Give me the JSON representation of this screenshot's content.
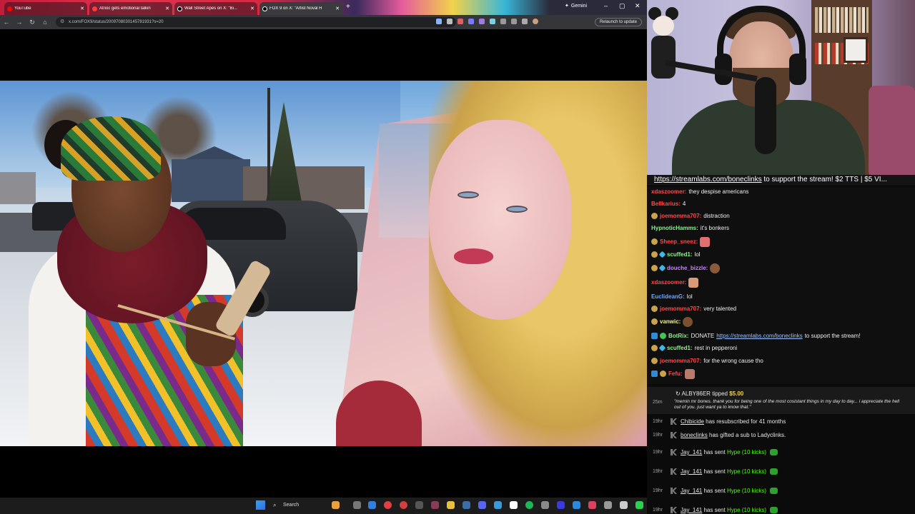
{
  "browser": {
    "tabs": [
      {
        "label": "YouTube"
      },
      {
        "label": "Atrioc gets emotional talkin"
      },
      {
        "label": "Wall Street Apes on X: \"Bi..."
      },
      {
        "label": "FOX 9 on X: \"Artist Noval H"
      }
    ],
    "profile_label": "Gemini",
    "url": "x.com/FOX9/status/2009708030145781931?s=20",
    "relaunch_label": "Relaunch to update"
  },
  "stream": {
    "ticker_link": "https://streamlabs.com/boneclinks",
    "ticker_text": " to support the stream! $2 TTS | $5 VI..."
  },
  "chat": {
    "messages": [
      {
        "user": "",
        "text": "they despise americans",
        "user_color": "#ff4a4a"
      },
      {
        "user": "Bellkarius:",
        "text": "4",
        "user_color": "#ff4a4a"
      },
      {
        "user": "joemomma707:",
        "text": "distraction",
        "user_color": "#ff4a4a"
      },
      {
        "user": "HypnoticHamms:",
        "text": "it's bonkers",
        "user_color": "#8ff28f"
      },
      {
        "user": "Sheep_sneez:",
        "text": "",
        "user_color": "#ff4a4a"
      },
      {
        "user": "scuffed1:",
        "text": "lol",
        "user_color": "#8ff28f"
      },
      {
        "user": "douche_bizzle:",
        "text": "",
        "user_color": "#c983ff"
      },
      {
        "user": "xdaszoomer:",
        "text": "",
        "user_color": "#ff4a4a"
      },
      {
        "user": "EuclideanG:",
        "text": "lol",
        "user_color": "#6fa8ff"
      },
      {
        "user": "joemomma707:",
        "text": "very talented",
        "user_color": "#ff4a4a"
      },
      {
        "user": "vanwic:",
        "text": "",
        "user_color": "#f2f28f"
      },
      {
        "user": "BotRix:",
        "text": "DONATE ",
        "link": "https://streamlabs.com/boneclinks",
        "text2": " to support the stream!",
        "user_color": "#8ff28f"
      },
      {
        "user": "scuffed1:",
        "text": "rest in pepperoni",
        "user_color": "#8ff28f"
      },
      {
        "user": "joemomma707:",
        "text": "for the wrong cause tho",
        "user_color": "#ff4a4a"
      },
      {
        "user": "Fefu:",
        "text": "",
        "user_color": "#ff4a4a"
      }
    ]
  },
  "events": {
    "tip": {
      "time": "25m",
      "user": "ALBY86ER",
      "action": "tipped",
      "amount": "$5.00",
      "message": "\"memin mr bones. thank you for being one of the most cosistant things in my day to day... i appreciate the hell out of you. just want ya to know that.\""
    },
    "items": [
      {
        "time": "19hr",
        "user": "Chibicide",
        "text": " has resubscribed for 41 months",
        "hype": ""
      },
      {
        "time": "19hr",
        "user": "boneclinks",
        "text": " has gifted a sub to Ladyclinks.",
        "hype": ""
      },
      {
        "time": "19hr",
        "user": "Jay_141",
        "text": " has sent ",
        "hype": "Hype (10 kicks)"
      },
      {
        "time": "19hr",
        "user": "Jay_141",
        "text": " has sent ",
        "hype": "Hype (10 kicks)"
      },
      {
        "time": "19hr",
        "user": "Jay_141",
        "text": " has sent ",
        "hype": "Hype (10 kicks)"
      },
      {
        "time": "19hr",
        "user": "Jay_141",
        "text": " has sent ",
        "hype": "Hype (10 kicks)"
      }
    ]
  },
  "taskbar": {
    "search_label": "Search"
  },
  "colors": {
    "hype_green": "#53fc18",
    "tip_gold": "#f7d34a",
    "link_blue": "#9dc4ff"
  }
}
